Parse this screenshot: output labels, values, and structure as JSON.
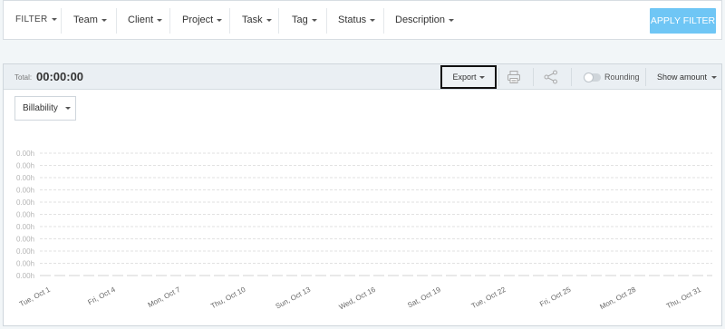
{
  "filter_bar": {
    "items": [
      {
        "label": "FILTER"
      },
      {
        "label": "Team"
      },
      {
        "label": "Client"
      },
      {
        "label": "Project"
      },
      {
        "label": "Task"
      },
      {
        "label": "Tag"
      },
      {
        "label": "Status"
      },
      {
        "label": "Description"
      }
    ],
    "apply_label": "APPLY FILTER"
  },
  "report": {
    "total_label": "Total:",
    "total_value": "00:00:00",
    "export_label": "Export",
    "rounding_label": "Rounding",
    "show_amount_label": "Show amount",
    "billability_label": "Billability"
  },
  "colors": {
    "accent": "#6fc6f5",
    "gridline": "#e2e2e2",
    "axis_text": "#999999"
  },
  "chart_data": {
    "type": "bar",
    "categories": [
      "Tue, Oct 1",
      "Fri, Oct 4",
      "Mon, Oct 7",
      "Thu, Oct 10",
      "Sun, Oct 13",
      "Wed, Oct 16",
      "Sat, Oct 19",
      "Tue, Oct 22",
      "Fri, Oct 25",
      "Mon, Oct 28",
      "Thu, Oct 31"
    ],
    "y_tick_labels": [
      "0.00h",
      "0.00h",
      "0.00h",
      "0.00h",
      "0.00h",
      "0.00h",
      "0.00h",
      "0.00h",
      "0.00h",
      "0.00h",
      "0.00h"
    ],
    "values": [
      0,
      0,
      0,
      0,
      0,
      0,
      0,
      0,
      0,
      0,
      0
    ],
    "grid": true
  }
}
